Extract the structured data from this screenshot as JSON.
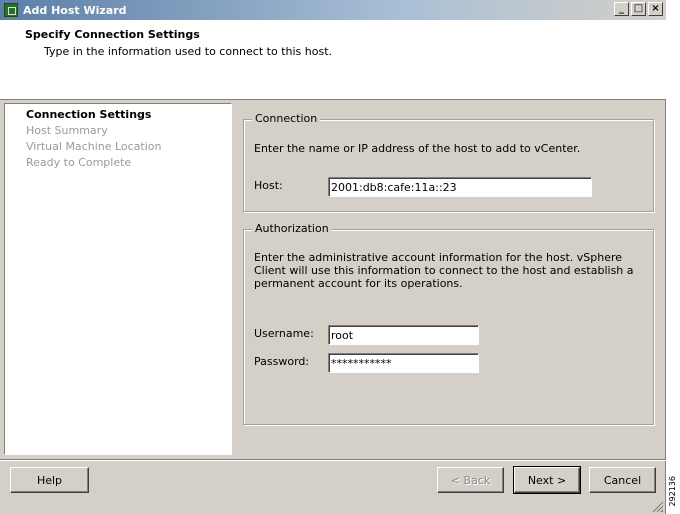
{
  "window": {
    "title": "Add Host Wizard",
    "controls": {
      "minimize": "_",
      "maximize": "□",
      "close": "×"
    }
  },
  "header": {
    "title": "Specify Connection Settings",
    "subtitle": "Type in the information used to connect to this host."
  },
  "steps": [
    {
      "label": "Connection Settings",
      "active": true
    },
    {
      "label": "Host Summary",
      "active": false
    },
    {
      "label": "Virtual Machine Location",
      "active": false
    },
    {
      "label": "Ready to Complete",
      "active": false
    }
  ],
  "connection": {
    "group_label": "Connection",
    "description": "Enter the name or IP address of the host to add to vCenter.",
    "host_label": "Host:",
    "host_value": "2001:db8:cafe:11a::23"
  },
  "authorization": {
    "group_label": "Authorization",
    "description": "Enter the administrative account information for the host. vSphere Client will use this information to connect to the host and establish a permanent account for its operations.",
    "username_label": "Username:",
    "username_value": "root",
    "password_label": "Password:",
    "password_value": "***********"
  },
  "buttons": {
    "help": "Help",
    "back": "< Back",
    "next": "Next >",
    "cancel": "Cancel"
  },
  "side_tag": "292136"
}
